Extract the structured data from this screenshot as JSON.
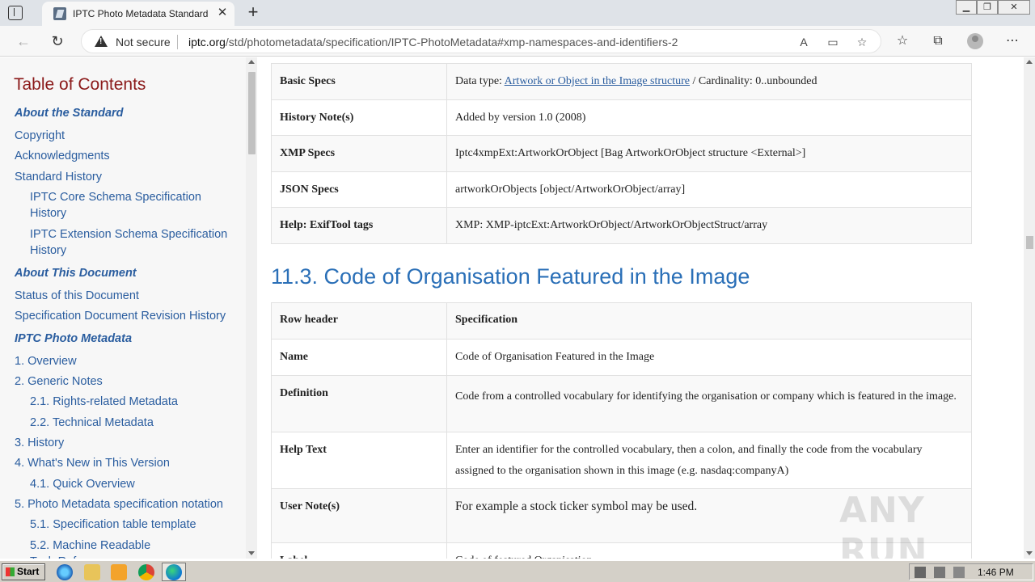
{
  "browser": {
    "tab_title": "IPTC Photo Metadata Standard",
    "url_domain": "iptc.org",
    "url_path": "/std/photometadata/specification/IPTC-PhotoMetadata#xmp-namespaces-and-identifiers-2",
    "not_secure_label": "Not secure",
    "new_tab": "+",
    "tab_close": "✕"
  },
  "toc": {
    "title": "Table of Contents",
    "items": [
      {
        "label": "About the Standard",
        "level": "section"
      },
      {
        "label": "Copyright",
        "level": "1"
      },
      {
        "label": "Acknowledgments",
        "level": "1"
      },
      {
        "label": "Standard History",
        "level": "1"
      },
      {
        "label": "IPTC Core Schema Specification",
        "level": "2"
      },
      {
        "label": "History",
        "level": "2"
      },
      {
        "label": "IPTC Extension Schema Specification",
        "level": "2"
      },
      {
        "label": "History",
        "level": "2"
      },
      {
        "label": "About This Document",
        "level": "section"
      },
      {
        "label": "Status of this Document",
        "level": "1"
      },
      {
        "label": "Specification Document Revision History",
        "level": "1"
      },
      {
        "label": "IPTC Photo Metadata",
        "level": "section"
      },
      {
        "label": "1. Overview",
        "level": "1"
      },
      {
        "label": "2. Generic Notes",
        "level": "1"
      },
      {
        "label": "2.1. Rights-related Metadata",
        "level": "2"
      },
      {
        "label": "2.2. Technical Metadata",
        "level": "2"
      },
      {
        "label": "3. History",
        "level": "1"
      },
      {
        "label": "4. What's New in This Version",
        "level": "1"
      },
      {
        "label": "4.1. Quick Overview",
        "level": "2"
      },
      {
        "label": "5. Photo Metadata specification notation",
        "level": "1"
      },
      {
        "label": "5.1. Specification table template",
        "level": "2"
      },
      {
        "label": "5.2. Machine Readable",
        "level": "2"
      },
      {
        "label": "Tech Reference",
        "level": "2"
      }
    ]
  },
  "table1": {
    "basic_specs_label": "Basic Specs",
    "basic_specs_prefix": "Data type: ",
    "basic_specs_link": "Artwork or Object in the Image structure",
    "basic_specs_suffix": " / Cardinality: 0..unbounded",
    "history_label": "History Note(s)",
    "history_value": "Added by version 1.0 (2008)",
    "xmp_label": "XMP Specs",
    "xmp_value": "Iptc4xmpExt:ArtworkOrObject [Bag ArtworkOrObject structure <External>]",
    "json_label": "JSON Specs",
    "json_value": "artworkOrObjects [object/ArtworkOrObject/array]",
    "exif_label": "Help: ExifTool tags",
    "exif_value": "XMP: XMP-iptcExt:ArtworkOrObject/ArtworkOrObjectStruct/array"
  },
  "section_heading": "11.3. Code of Organisation Featured in the Image",
  "table2": {
    "row_header_label": "Row header",
    "spec_label": "Specification",
    "name_label": "Name",
    "name_value": "Code of Organisation Featured in the Image",
    "definition_label": "Definition",
    "definition_value": "Code from a controlled vocabulary for identifying the organisation or company which is featured in the image.",
    "help_label": "Help Text",
    "help_value": "Enter an identifier for the controlled vocabulary, then a colon, and finally the code from the vocabulary assigned to the organisation shown in this image (e.g. nasdaq:companyA)",
    "user_note_label": "User Note(s)",
    "user_note_value": "For example a stock ticker symbol may be used.",
    "label_label": "Label",
    "label_value": "Code of featured Organisation"
  },
  "watermark": "ANY RUN",
  "taskbar": {
    "start_label": "Start",
    "clock": "1:46 PM"
  }
}
